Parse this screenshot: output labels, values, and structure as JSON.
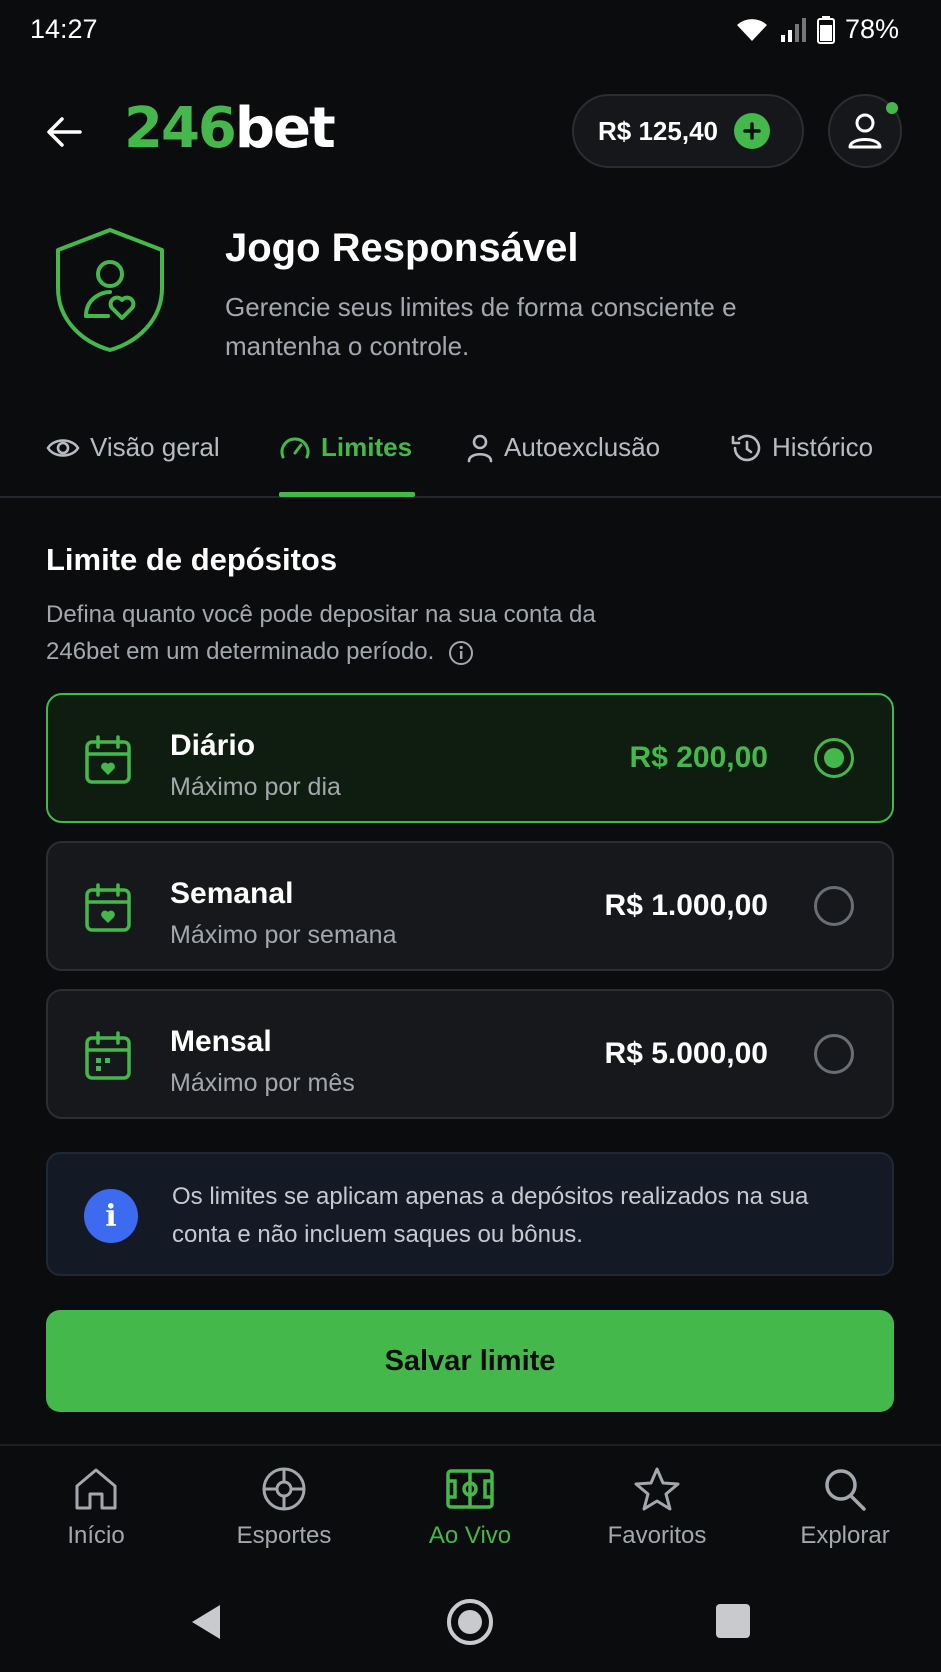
{
  "status": {
    "time": "14:27",
    "battery": "78%"
  },
  "header": {
    "logo_num": "246",
    "logo_text": "bet",
    "balance": "R$ 125,40"
  },
  "hero": {
    "title": "Jogo Responsável",
    "subtitle": "Gerencie seus limites de forma consciente e mantenha o controle."
  },
  "tabs": [
    {
      "label": "Visão geral",
      "icon": "eye-icon"
    },
    {
      "label": "Limites",
      "icon": "gauge-icon"
    },
    {
      "label": "Autoexclusão",
      "icon": "user-icon"
    },
    {
      "label": "Histórico",
      "icon": "history-icon"
    }
  ],
  "active_tab": "Limites",
  "section": {
    "title": "Limite de depósitos",
    "description": "Defina quanto você pode depositar na sua conta da 246bet em um determinado período."
  },
  "options": [
    {
      "title": "Diário",
      "subtitle": "Máximo por dia",
      "amount": "R$ 200,00",
      "selected": true
    },
    {
      "title": "Semanal",
      "subtitle": "Máximo por semana",
      "amount": "R$ 1.000,00",
      "selected": false
    },
    {
      "title": "Mensal",
      "subtitle": "Máximo por mês",
      "amount": "R$ 5.000,00",
      "selected": false
    }
  ],
  "info": {
    "icon_text": "i",
    "text": "Os limites se aplicam apenas a depósitos realizados na sua conta e não incluem saques ou bônus."
  },
  "save_label": "Salvar limite",
  "nav": [
    {
      "label": "Início",
      "icon": "home-icon"
    },
    {
      "label": "Esportes",
      "icon": "ball-icon"
    },
    {
      "label": "Ao Vivo",
      "icon": "field-icon"
    },
    {
      "label": "Favoritos",
      "icon": "star-icon"
    },
    {
      "label": "Explorar",
      "icon": "search-icon"
    }
  ],
  "active_nav": "Ao Vivo",
  "colors": {
    "accent": "#44b84a",
    "background": "#0b0c0e",
    "info": "#3d6bf0"
  }
}
